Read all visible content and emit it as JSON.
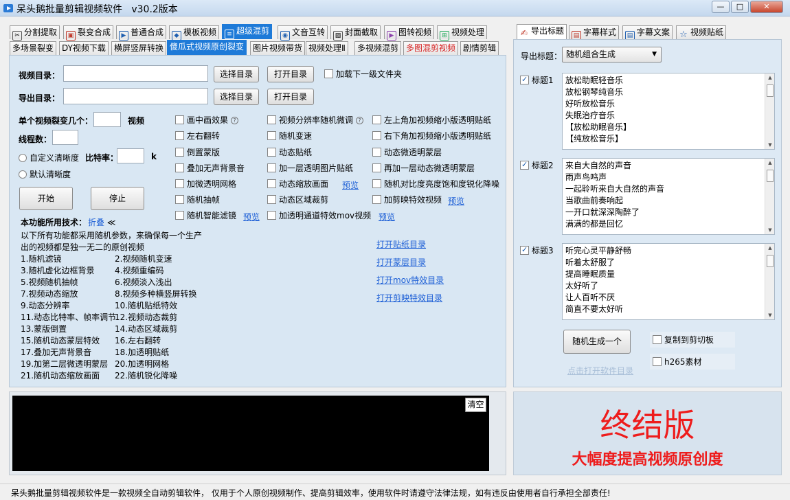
{
  "window": {
    "title": "呆头鹅批量剪辑视频软件   v30.2版本",
    "min": "—",
    "max": "□",
    "close": "✕"
  },
  "top_tabs": [
    {
      "label": "分割提取",
      "icon": "scissors-icon",
      "glyph": "✂"
    },
    {
      "label": "裂变合成",
      "icon": "merge-icon",
      "glyph": "▣"
    },
    {
      "label": "普通合成",
      "icon": "play-icon",
      "glyph": "▶"
    },
    {
      "label": "模板视频",
      "icon": "template-icon",
      "glyph": "◆"
    },
    {
      "label": "超级混剪",
      "icon": "waveform-icon",
      "glyph": "≡"
    },
    {
      "label": "文音互转",
      "icon": "microphone-icon",
      "glyph": "◉"
    },
    {
      "label": "封面截取",
      "icon": "image-icon",
      "glyph": "▨"
    },
    {
      "label": "图转视频",
      "icon": "picture-video-icon",
      "glyph": "▶"
    },
    {
      "label": "视频处理",
      "icon": "video-process-icon",
      "glyph": "⊞"
    }
  ],
  "sub_tabs": [
    "多场景裂变",
    "DY视频下载",
    "横屏竖屏转换",
    "傻瓜式视频原创裂变",
    "图片视频带货",
    "视频处理Ⅱ",
    "多视频混剪",
    "多图混剪视频",
    "剧情剪辑"
  ],
  "form": {
    "video_dir_label": "视频目录：",
    "export_dir_label": "导出目录：",
    "video_dir_value": "",
    "export_dir_value": "",
    "select_dir": "选择目录",
    "open_dir": "打开目录",
    "load_subfolder": "加载下一级文件夹",
    "per_video_label": "单个视频裂变几个：",
    "per_video_unit": "视频",
    "per_video_value": "",
    "threads_label": "线程数：",
    "threads_value": "",
    "custom_clarity": "自定义清晰度",
    "bitrate_label": "比特率：",
    "bitrate_unit": "k",
    "bitrate_value": "",
    "default_clarity": "默认清晰度",
    "start": "开始",
    "stop": "停止",
    "tech_label": "本功能所用技术：",
    "fold": "折叠",
    "fold_arrow": "≪"
  },
  "options": {
    "col1": [
      "画中画效果",
      "左右翻转",
      "倒置蒙版",
      "叠加无声背景音",
      "加微透明网格",
      "随机抽帧",
      "随机智能滤镜"
    ],
    "col2": [
      "视频分辨率随机微调",
      "随机变速",
      "动态贴纸",
      "加一层透明图片贴纸",
      "动态缩放画面",
      "动态区域裁剪",
      "加透明通道特效mov视频"
    ],
    "col3": [
      "左上角加视频缩小版透明贴纸",
      "右下角加视频缩小版透明贴纸",
      "动态微透明蒙层",
      "再加一层动态微透明蒙层",
      "随机对比度亮度饱和度锐化降噪",
      "加剪映特效视频"
    ],
    "preview": "预览"
  },
  "description": {
    "intro": [
      "以下所有功能都采用随机参数，来确保每一个生产",
      "出的视频都是独一无二的原创视频"
    ],
    "left": [
      "1.随机滤镜",
      "3.随机虚化边框背景",
      "5.视频随机抽帧",
      "7.视频动态缩放",
      "9.动态分辨率",
      "11.动态比特率、帧率调节",
      "13.蒙版倒置",
      "15.随机动态蒙层特效",
      "17.叠加无声背景音",
      "19.加第二层微透明蒙层",
      "21.随机动态缩放画面"
    ],
    "right": [
      "2.视频随机变速",
      "4.视频重编码",
      "6.视频淡入浅出",
      "8.视频多种横竖屏转换",
      "10.随机贴纸特效",
      "12.视频动态裁剪",
      "14.动态区域裁剪",
      "16.左右翻转",
      "18.加透明贴纸",
      "20.加透明网格",
      "22.随机锐化降噪"
    ]
  },
  "links": [
    "打开贴纸目录",
    "打开蒙层目录",
    "打开mov特效目录",
    "打开剪映特效目录"
  ],
  "log": {
    "clear": "清空"
  },
  "right_tabs": [
    {
      "label": "导出标题",
      "icon": "title-icon",
      "glyph": "✍"
    },
    {
      "label": "字幕样式",
      "icon": "subtitle-style-icon",
      "glyph": "▤"
    },
    {
      "label": "字幕文案",
      "icon": "subtitle-text-icon",
      "glyph": "▤"
    },
    {
      "label": "视频贴纸",
      "icon": "star-icon",
      "glyph": "☆"
    }
  ],
  "titles": {
    "export_label": "导出标题：",
    "mode": "随机组合生成",
    "groups": [
      {
        "label": "标题1",
        "lines": [
          "放松助眠轻音乐",
          "放松钢琴纯音乐",
          "好听放松音乐",
          "失眠治疗音乐",
          "【放松助眠音乐】",
          "【纯放松音乐】"
        ]
      },
      {
        "label": "标题2",
        "lines": [
          "来自大自然的声音",
          "雨声鸟鸣声",
          "一起聆听来自大自然的声音",
          "当歌曲前奏响起",
          "一开口就深深陶醉了",
          "满满的都是回忆"
        ]
      },
      {
        "label": "标题3",
        "lines": [
          "听完心灵平静舒畅",
          "听着太舒服了",
          "提高睡眠质量",
          "太好听了",
          "让人百听不厌",
          "简直不要太好听"
        ]
      }
    ],
    "generate": "随机生成一个",
    "copy": "复制到剪切板",
    "h265": "h265素材",
    "open_dir": "点击打开软件目录"
  },
  "banner": {
    "title": "终结版",
    "subtitle": "大幅度提高视频原创度",
    "color": "#ee1c1c"
  },
  "status": "呆头鹅批量剪辑视频软件是一款视频全自动剪辑软件， 仅用于个人原创视频制作、提高剪辑效率，使用软件时请遵守法律法规，如有违反由使用者自行承担全部责任!"
}
